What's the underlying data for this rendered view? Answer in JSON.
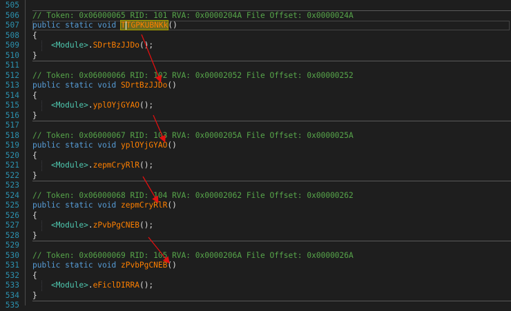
{
  "lines": [
    {
      "n": "505",
      "parts": []
    },
    {
      "n": "506",
      "parts": [
        {
          "c": "cm",
          "t": "// Token: 0x06000065 RID: 101 RVA: 0x0000204A File Offset: 0x0000024A"
        }
      ]
    },
    {
      "n": "507",
      "current": true,
      "parts": [
        {
          "c": "kw",
          "t": "public static void "
        },
        {
          "c": "hl",
          "t": "TTGPKUBNKk"
        },
        {
          "c": "tx",
          "t": "()"
        }
      ]
    },
    {
      "n": "508",
      "parts": [
        {
          "c": "tx",
          "t": "{"
        }
      ]
    },
    {
      "n": "509",
      "parts": [
        {
          "c": "tx",
          "t": "    "
        },
        {
          "c": "ty",
          "t": "<Module>"
        },
        {
          "c": "tx",
          "t": "."
        },
        {
          "c": "fn",
          "t": "SDrtBzJJDo"
        },
        {
          "c": "tx",
          "t": "();"
        }
      ]
    },
    {
      "n": "510",
      "parts": [
        {
          "c": "tx",
          "t": "}"
        }
      ]
    },
    {
      "n": "511",
      "parts": []
    },
    {
      "n": "512",
      "parts": [
        {
          "c": "cm",
          "t": "// Token: 0x06000066 RID: 102 RVA: 0x00002052 File Offset: 0x00000252"
        }
      ]
    },
    {
      "n": "513",
      "parts": [
        {
          "c": "kw",
          "t": "public static void "
        },
        {
          "c": "fn",
          "t": "SDrtBzJJDo"
        },
        {
          "c": "tx",
          "t": "()"
        }
      ]
    },
    {
      "n": "514",
      "parts": [
        {
          "c": "tx",
          "t": "{"
        }
      ]
    },
    {
      "n": "515",
      "parts": [
        {
          "c": "tx",
          "t": "    "
        },
        {
          "c": "ty",
          "t": "<Module>"
        },
        {
          "c": "tx",
          "t": "."
        },
        {
          "c": "fn",
          "t": "yplOYjGYAO"
        },
        {
          "c": "tx",
          "t": "();"
        }
      ]
    },
    {
      "n": "516",
      "parts": [
        {
          "c": "tx",
          "t": "}"
        }
      ]
    },
    {
      "n": "517",
      "parts": []
    },
    {
      "n": "518",
      "parts": [
        {
          "c": "cm",
          "t": "// Token: 0x06000067 RID: 103 RVA: 0x0000205A File Offset: 0x0000025A"
        }
      ]
    },
    {
      "n": "519",
      "parts": [
        {
          "c": "kw",
          "t": "public static void "
        },
        {
          "c": "fn",
          "t": "yplOYjGYAO"
        },
        {
          "c": "tx",
          "t": "()"
        }
      ]
    },
    {
      "n": "520",
      "parts": [
        {
          "c": "tx",
          "t": "{"
        }
      ]
    },
    {
      "n": "521",
      "parts": [
        {
          "c": "tx",
          "t": "    "
        },
        {
          "c": "ty",
          "t": "<Module>"
        },
        {
          "c": "tx",
          "t": "."
        },
        {
          "c": "fn",
          "t": "zepmCryRlR"
        },
        {
          "c": "tx",
          "t": "();"
        }
      ]
    },
    {
      "n": "522",
      "parts": [
        {
          "c": "tx",
          "t": "}"
        }
      ]
    },
    {
      "n": "523",
      "parts": []
    },
    {
      "n": "524",
      "parts": [
        {
          "c": "cm",
          "t": "// Token: 0x06000068 RID: 104 RVA: 0x00002062 File Offset: 0x00000262"
        }
      ]
    },
    {
      "n": "525",
      "parts": [
        {
          "c": "kw",
          "t": "public static void "
        },
        {
          "c": "fn",
          "t": "zepmCryRlR"
        },
        {
          "c": "tx",
          "t": "()"
        }
      ]
    },
    {
      "n": "526",
      "parts": [
        {
          "c": "tx",
          "t": "{"
        }
      ]
    },
    {
      "n": "527",
      "parts": [
        {
          "c": "tx",
          "t": "    "
        },
        {
          "c": "ty",
          "t": "<Module>"
        },
        {
          "c": "tx",
          "t": "."
        },
        {
          "c": "fn",
          "t": "zPvbPgCNEB"
        },
        {
          "c": "tx",
          "t": "();"
        }
      ]
    },
    {
      "n": "528",
      "parts": [
        {
          "c": "tx",
          "t": "}"
        }
      ]
    },
    {
      "n": "529",
      "parts": []
    },
    {
      "n": "530",
      "parts": [
        {
          "c": "cm",
          "t": "// Token: 0x06000069 RID: 105 RVA: 0x0000206A File Offset: 0x0000026A"
        }
      ]
    },
    {
      "n": "531",
      "parts": [
        {
          "c": "kw",
          "t": "public static void "
        },
        {
          "c": "fn",
          "t": "zPvbPgCNEB"
        },
        {
          "c": "tx",
          "t": "()"
        }
      ]
    },
    {
      "n": "532",
      "parts": [
        {
          "c": "tx",
          "t": "{"
        }
      ]
    },
    {
      "n": "533",
      "parts": [
        {
          "c": "tx",
          "t": "    "
        },
        {
          "c": "ty",
          "t": "<Module>"
        },
        {
          "c": "tx",
          "t": "."
        },
        {
          "c": "fn",
          "t": "eFiclDIRRA"
        },
        {
          "c": "tx",
          "t": "();"
        }
      ]
    },
    {
      "n": "534",
      "parts": [
        {
          "c": "tx",
          "t": "}"
        }
      ]
    },
    {
      "n": "535",
      "parts": []
    }
  ],
  "colors": {
    "background": "#1e1e1e",
    "line_number": "#2b91af",
    "comment": "#57a64a",
    "keyword": "#569cd6",
    "method": "#ff8000",
    "type": "#4ec9b0",
    "plain": "#dcdcdc",
    "arrow": "#e01010"
  },
  "annotations": {
    "arrow_icon": "red-arrow-icon",
    "arrow_count": 5
  }
}
